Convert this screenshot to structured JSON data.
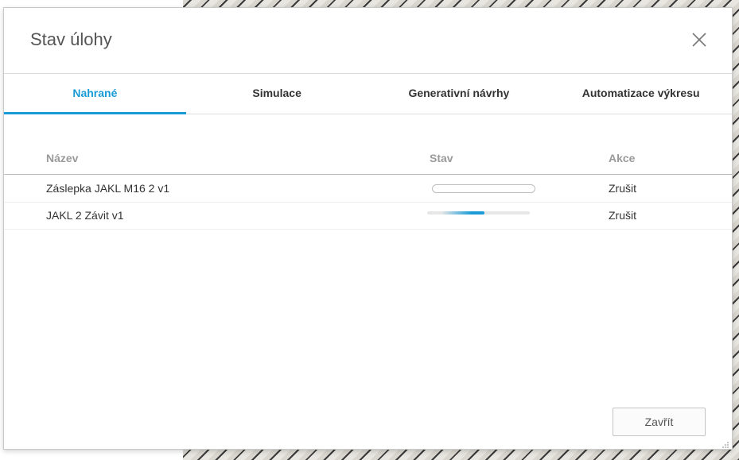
{
  "dialog": {
    "title": "Stav úlohy",
    "close_icon": "close-icon",
    "tabs": [
      {
        "label": "Nahrané",
        "active": true
      },
      {
        "label": "Simulace",
        "active": false
      },
      {
        "label": "Generativní návrhy",
        "active": false
      },
      {
        "label": "Automatizace výkresu",
        "active": false
      }
    ],
    "table": {
      "columns": [
        "Název",
        "Stav",
        "Akce"
      ],
      "rows": [
        {
          "name": "Záslepka JAKL M16 2 v1",
          "status": "progress-empty",
          "action": "Zrušit"
        },
        {
          "name": "JAKL 2 Závit v1",
          "status": "progress-indeterminate",
          "action": "Zrušit"
        }
      ]
    },
    "close_button": "Zavřít",
    "accent_color": "#1a9bd7"
  }
}
